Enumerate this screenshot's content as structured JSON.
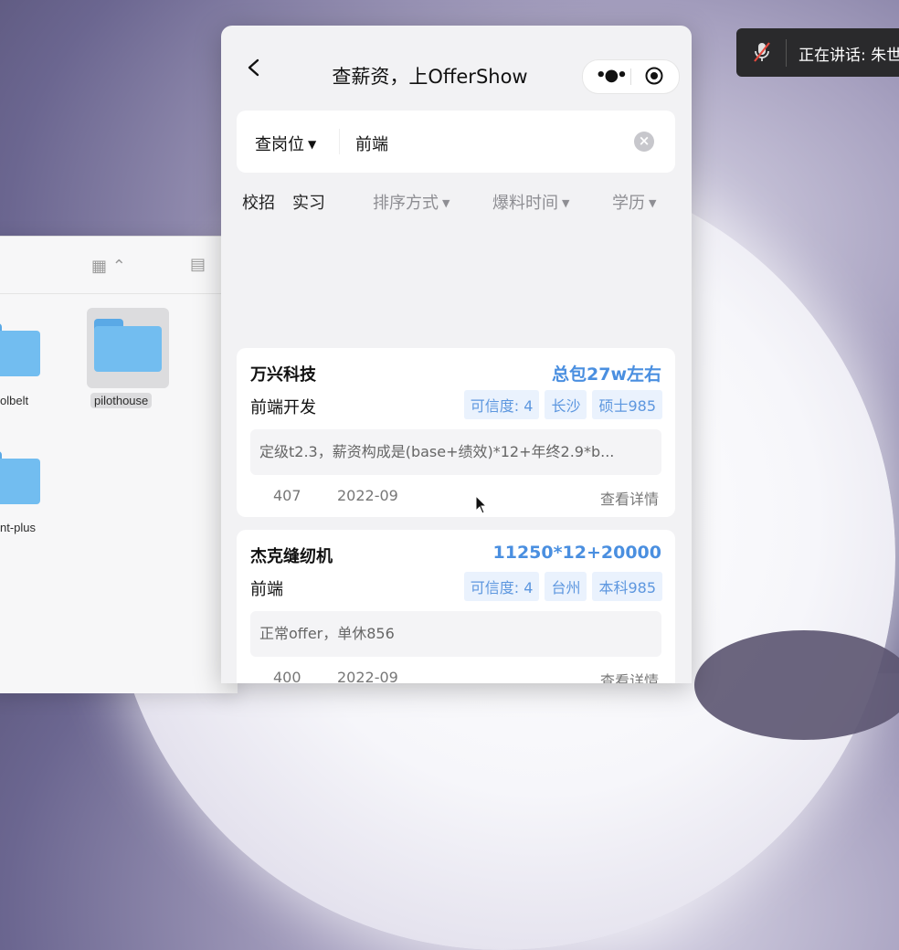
{
  "speaking": {
    "text": "正在讲话: 朱世"
  },
  "finder": {
    "folders": [
      {
        "label": "olbelt"
      },
      {
        "label": "pilothouse"
      },
      {
        "label": "nt-plus"
      }
    ]
  },
  "miniapp": {
    "title": "查薪资，上OfferShow",
    "search": {
      "type_label": "查岗位",
      "value": "前端"
    },
    "filters": {
      "campus": "校招",
      "intern": "实习",
      "sort": "排序方式",
      "time": "爆料时间",
      "education": "学历"
    },
    "cards": [
      {
        "company": "万兴科技",
        "salary": "总包27w左右",
        "position": "前端开发",
        "tags": [
          "可信度: 4",
          "长沙",
          "硕士985"
        ],
        "description": "定级t2.3，薪资构成是(base+绩效)*12+年终2.9*b...",
        "views": "407",
        "date": "2022-09",
        "detail_label": "查看详情"
      },
      {
        "company": "杰克缝纫机",
        "salary": "11250*12+20000",
        "position": "前端",
        "tags": [
          "可信度: 4",
          "台州",
          "本科985"
        ],
        "description": "正常offer，单休856",
        "views": "400",
        "date": "2022-09",
        "detail_label": "查看详情"
      }
    ]
  },
  "colors": {
    "accent": "#4a8fe0",
    "tag_bg": "#eaf2fd",
    "tag_text": "#5d97df"
  }
}
